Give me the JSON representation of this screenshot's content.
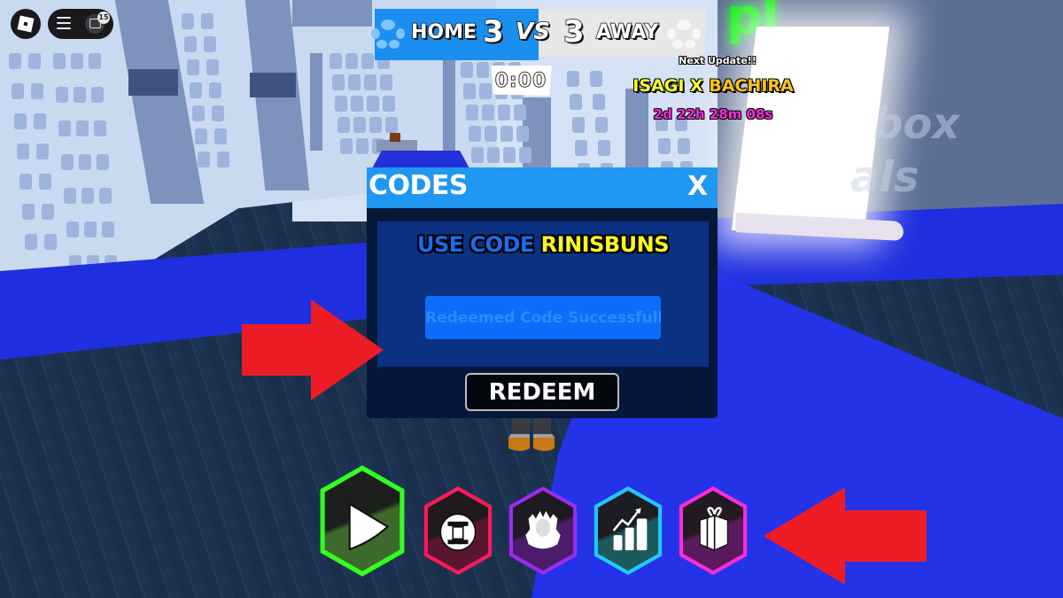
{
  "topbar": {
    "roblox_logo": "roblox-logo",
    "menu_icon": "hamburger-menu-icon",
    "chat_icon": "chat-icon",
    "chat_badge": "15"
  },
  "scoreboard": {
    "home_label": "HOME",
    "home_score": "3",
    "vs_label": "VS",
    "away_score": "3",
    "away_label": "AWAY",
    "timer": "0:00",
    "home_color": "#1a8ff0",
    "away_color": "#e7e7e7"
  },
  "update_banner": {
    "heading": "Next Update!!",
    "collab_part1": "ISAGI X ",
    "collab_part2": "BACHIRA",
    "countdown": "2d 22h 28m 08s"
  },
  "codes_modal": {
    "title": "CODES",
    "close_label": "X",
    "promo_prefix": "USE CODE ",
    "promo_code": "RINISBUNS",
    "input_value": "",
    "input_placeholder": "Redeemed Code Successfully",
    "redeem_label": "REDEEM",
    "header_color": "#1f97f3",
    "body_color": "#07173a"
  },
  "hud_buttons": [
    {
      "name": "play",
      "icon": "play-icon",
      "border": "#33ff22",
      "fill_top": "#1c1f1c",
      "fill_bottom": "#3f6a2d"
    },
    {
      "name": "spin",
      "icon": "spin-wheel-icon",
      "border": "#ff1a5a",
      "fill_top": "#1f1a1d",
      "fill_bottom": "#5a1630"
    },
    {
      "name": "styles",
      "icon": "character-aura-icon",
      "border": "#9b2cf0",
      "fill_top": "#1e1a24",
      "fill_bottom": "#4a1c6a"
    },
    {
      "name": "upgrades",
      "icon": "stats-chart-icon",
      "border": "#22c8ff",
      "fill_top": "#1b1d22",
      "fill_bottom": "#1d5a5e"
    },
    {
      "name": "codes",
      "icon": "gift-icon",
      "border": "#ff2bd8",
      "fill_top": "#221a22",
      "fill_bottom": "#5a1a5e"
    }
  ],
  "annotations": {
    "arrow_color": "#ed1c24"
  },
  "scene_text": {
    "neon_sign": "pl",
    "wall_text_line1": "box",
    "wall_text_line2": "als"
  }
}
